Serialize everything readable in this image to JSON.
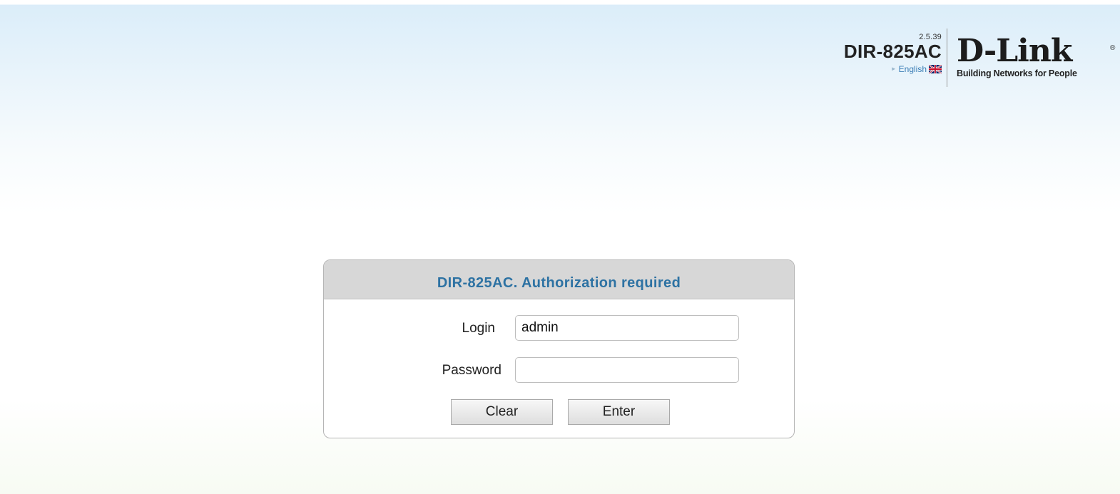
{
  "header": {
    "firmware_version": "2.5.39",
    "model": "DIR-825AC",
    "language_label": "English",
    "language_flag_icon": "uk-flag-icon",
    "logo_text": "D-Link",
    "logo_registered": "®",
    "tagline": "Building Networks for People"
  },
  "auth": {
    "title": "DIR-825AC. Authorization required",
    "login_label": "Login",
    "login_value": "admin",
    "password_label": "Password",
    "password_value": "",
    "clear_label": "Clear",
    "enter_label": "Enter"
  },
  "colors": {
    "title_text": "#2d72a3",
    "title_bar": "#d7d7d7",
    "header_gradient": "#dbedf9"
  }
}
